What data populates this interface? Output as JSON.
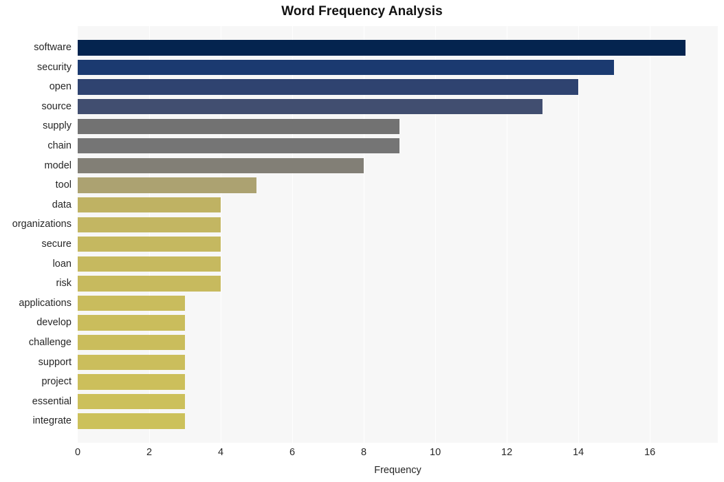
{
  "chart_data": {
    "type": "bar",
    "orientation": "horizontal",
    "title": "Word Frequency Analysis",
    "xlabel": "Frequency",
    "ylabel": "",
    "categories": [
      "software",
      "security",
      "open",
      "source",
      "supply",
      "chain",
      "model",
      "tool",
      "data",
      "organizations",
      "secure",
      "loan",
      "risk",
      "applications",
      "develop",
      "challenge",
      "support",
      "project",
      "essential",
      "integrate"
    ],
    "values": [
      17,
      15,
      14,
      13,
      9,
      9,
      8,
      5,
      4,
      4,
      4,
      4,
      4,
      3,
      3,
      3,
      3,
      3,
      3,
      3
    ],
    "bar_colors": [
      "#04244f",
      "#1b3a70",
      "#2f4370",
      "#414e70",
      "#727272",
      "#757575",
      "#827f76",
      "#aca271",
      "#bfb263",
      "#c3b662",
      "#c5b860",
      "#c6b95f",
      "#c7ba5e",
      "#c9bc5d",
      "#cabd5c",
      "#cabd5c",
      "#cbbe5c",
      "#ccbf5b",
      "#ccc05b",
      "#ccc15b"
    ],
    "xlim": [
      0,
      17.9
    ],
    "xticks": [
      0,
      2,
      4,
      6,
      8,
      10,
      12,
      14,
      16
    ],
    "xtick_labels": [
      "0",
      "2",
      "4",
      "6",
      "8",
      "10",
      "12",
      "14",
      "16"
    ],
    "grid": true,
    "grid_axis": "x",
    "grid_color": "#ffffff",
    "plot_background": "#f7f7f7",
    "figure_background": "#ffffff",
    "legend": null
  }
}
